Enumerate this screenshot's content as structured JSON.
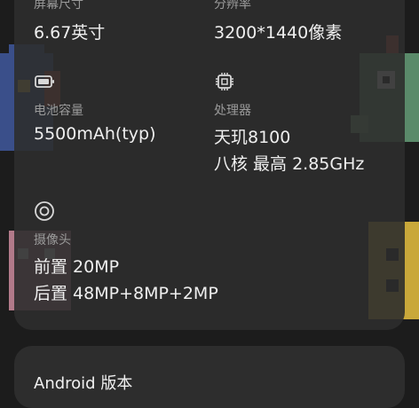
{
  "specs": {
    "screen": {
      "label": "屏幕尺寸",
      "value": "6.67英寸"
    },
    "resolution": {
      "label": "分辨率",
      "value": "3200*1440像素"
    },
    "battery": {
      "label": "电池容量",
      "value": "5500mAh(typ)",
      "icon": "battery-icon"
    },
    "processor": {
      "label": "处理器",
      "value_line1": "天玑8100",
      "value_line2": "八核 最高 2.85GHz",
      "icon": "chip-icon"
    },
    "camera": {
      "label": "摄像头",
      "front": "前置 20MP",
      "rear": "后置 48MP+8MP+2MP",
      "icon": "camera-icon"
    }
  },
  "android_section": {
    "title": "Android 版本"
  }
}
